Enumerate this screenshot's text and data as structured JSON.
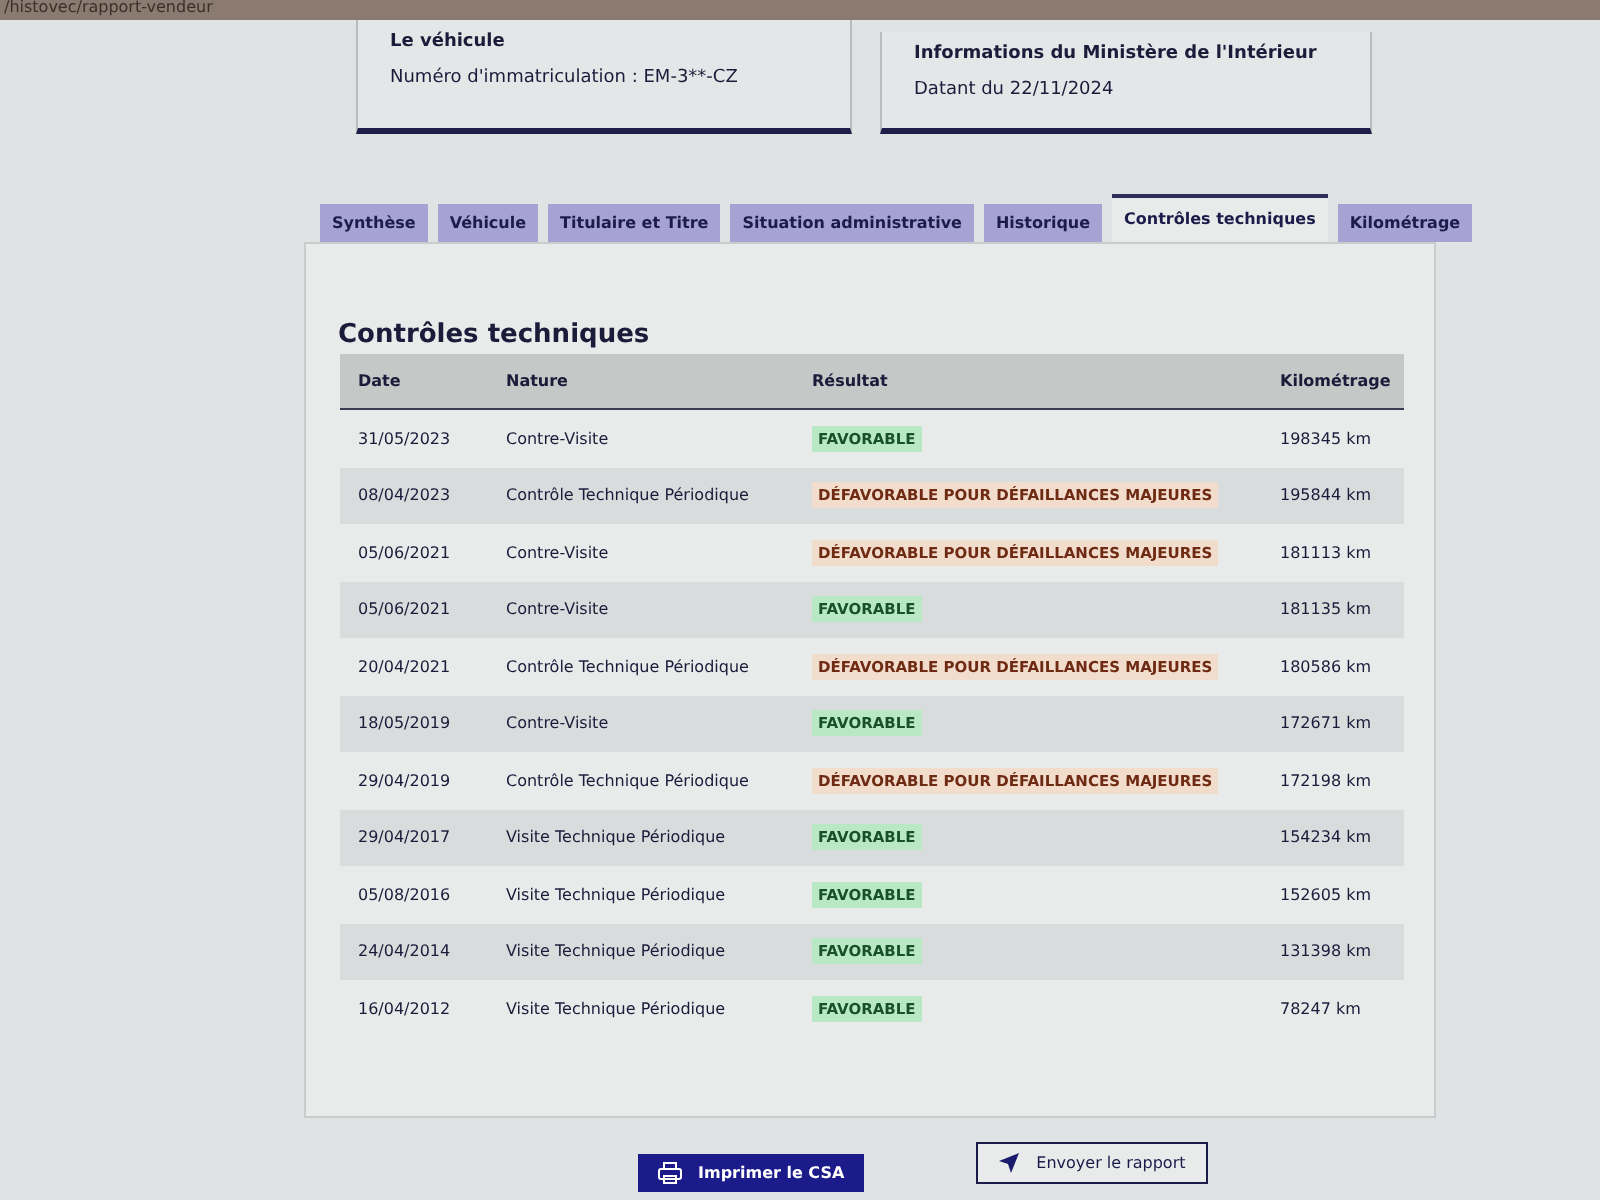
{
  "browser": {
    "url": "/histovec/rapport-vendeur"
  },
  "cards": [
    {
      "title": "Le véhicule",
      "text": "Numéro d'immatriculation : EM-3**-CZ"
    },
    {
      "title": "Informations du Ministère de l'Intérieur",
      "text": "Datant du 22/11/2024"
    }
  ],
  "tabs": [
    {
      "label": "Synthèse",
      "selected": false
    },
    {
      "label": "Véhicule",
      "selected": false
    },
    {
      "label": "Titulaire et Titre",
      "selected": false
    },
    {
      "label": "Situation administrative",
      "selected": false
    },
    {
      "label": "Historique",
      "selected": false
    },
    {
      "label": "Contrôles techniques",
      "selected": true
    },
    {
      "label": "Kilométrage",
      "selected": false
    }
  ],
  "section": {
    "title": "Contrôles techniques"
  },
  "table": {
    "columns": [
      "Date",
      "Nature",
      "Résultat",
      "Kilométrage"
    ],
    "rows": [
      {
        "date": "31/05/2023",
        "nature": "Contre-Visite",
        "result": "FAVORABLE",
        "kind": "favorable",
        "km": "198345 km"
      },
      {
        "date": "08/04/2023",
        "nature": "Contrôle Technique Périodique",
        "result": "DÉFAVORABLE POUR DÉFAILLANCES MAJEURES",
        "kind": "defavorable",
        "km": "195844 km"
      },
      {
        "date": "05/06/2021",
        "nature": "Contre-Visite",
        "result": "DÉFAVORABLE POUR DÉFAILLANCES MAJEURES",
        "kind": "defavorable",
        "km": "181113 km"
      },
      {
        "date": "05/06/2021",
        "nature": "Contre-Visite",
        "result": "FAVORABLE",
        "kind": "favorable",
        "km": "181135 km"
      },
      {
        "date": "20/04/2021",
        "nature": "Contrôle Technique Périodique",
        "result": "DÉFAVORABLE POUR DÉFAILLANCES MAJEURES",
        "kind": "defavorable",
        "km": "180586 km"
      },
      {
        "date": "18/05/2019",
        "nature": "Contre-Visite",
        "result": "FAVORABLE",
        "kind": "favorable",
        "km": "172671 km"
      },
      {
        "date": "29/04/2019",
        "nature": "Contrôle Technique Périodique",
        "result": "DÉFAVORABLE POUR DÉFAILLANCES MAJEURES",
        "kind": "defavorable",
        "km": "172198 km"
      },
      {
        "date": "29/04/2017",
        "nature": "Visite Technique Périodique",
        "result": "FAVORABLE",
        "kind": "favorable",
        "km": "154234 km"
      },
      {
        "date": "05/08/2016",
        "nature": "Visite Technique Périodique",
        "result": "FAVORABLE",
        "kind": "favorable",
        "km": "152605 km"
      },
      {
        "date": "24/04/2014",
        "nature": "Visite Technique Périodique",
        "result": "FAVORABLE",
        "kind": "favorable",
        "km": "131398 km"
      },
      {
        "date": "16/04/2012",
        "nature": "Visite Technique Périodique",
        "result": "FAVORABLE",
        "kind": "favorable",
        "km": "78247 km"
      }
    ]
  },
  "actions": [
    {
      "label": "Imprimer le CSA",
      "kind": "primary"
    },
    {
      "label": "Envoyer le rapport",
      "kind": "secondary"
    }
  ]
}
